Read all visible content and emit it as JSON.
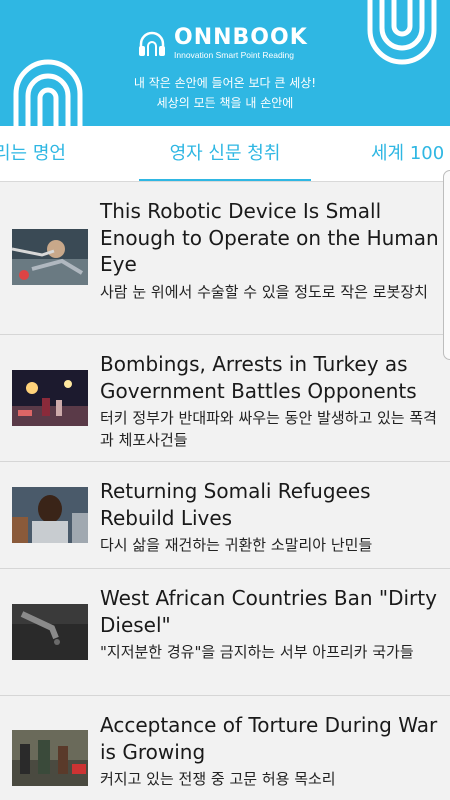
{
  "header": {
    "brand": "ONNBOOK",
    "tagline": "Innovation Smart Point Reading",
    "slogan_line1": "내 작은 손안에 들어온 보다 큰 세상!",
    "slogan_line2": "세상의 모든 책을 내 손안에",
    "color": "#2fb7e3"
  },
  "tabs": [
    {
      "label": "리는 명언"
    },
    {
      "label": "영자 신문 청취",
      "selected": true
    },
    {
      "label": "세계 100"
    }
  ],
  "articles": [
    {
      "title": "This Robotic Device Is Small Enough to Operate on the Human Eye",
      "subtitle": "사람 눈 위에서 수술할 수 있을 정도로 작은 로봇장치",
      "thumb_icon": "robotic-surgery-photo"
    },
    {
      "title": "Bombings, Arrests in Turkey as Government Battles Opponents",
      "subtitle": "터키 정부가 반대파와 싸우는 동안 발생하고 있는 폭격과 체포사건들",
      "thumb_icon": "night-street-scene-photo"
    },
    {
      "title": "Returning Somali Refugees Rebuild Lives",
      "subtitle": "다시 삶을 재건하는 귀환한 소말리아 난민들",
      "thumb_icon": "refugee-portrait-photo"
    },
    {
      "title": "West African Countries Ban \"Dirty Diesel\"",
      "subtitle": "\"지저분한 경유\"을 금지하는 서부 아프리카 국가들",
      "thumb_icon": "fuel-nozzle-photo"
    },
    {
      "title": "Acceptance of Torture During War is Growing",
      "subtitle": "커지고 있는 전쟁 중 고문 허용 목소리",
      "thumb_icon": "crowd-protest-photo"
    }
  ]
}
